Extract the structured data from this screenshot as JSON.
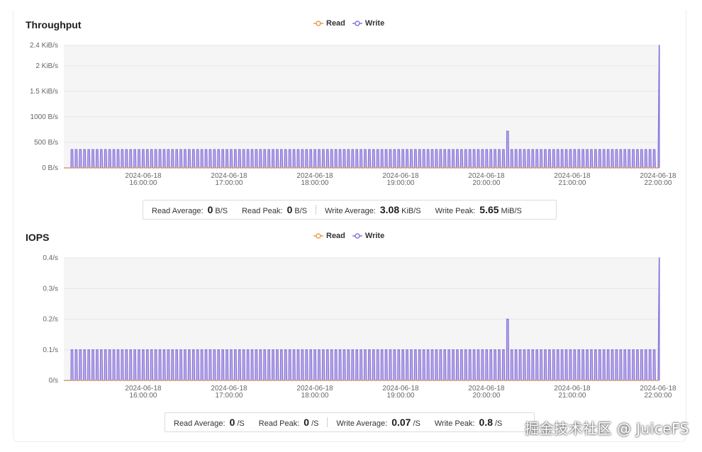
{
  "legend": {
    "read": "Read",
    "write": "Write"
  },
  "colors": {
    "read": "#e8a04a",
    "write": "#8a74dc",
    "grid": "#e6e6e6",
    "plot_bg": "#f5f5f5"
  },
  "throughput": {
    "title": "Throughput",
    "stats": {
      "read_avg_label": "Read Average:",
      "read_avg_value": "0",
      "read_avg_unit": "B/S",
      "read_peak_label": "Read Peak:",
      "read_peak_value": "0",
      "read_peak_unit": "B/S",
      "write_avg_label": "Write Average:",
      "write_avg_value": "3.08",
      "write_avg_unit": "KiB/S",
      "write_peak_label": "Write Peak:",
      "write_peak_value": "5.65",
      "write_peak_unit": "MiB/S"
    }
  },
  "iops": {
    "title": "IOPS",
    "stats": {
      "read_avg_label": "Read Average:",
      "read_avg_value": "0",
      "read_avg_unit": "/S",
      "read_peak_label": "Read Peak:",
      "read_peak_value": "0",
      "read_peak_unit": "/S",
      "write_avg_label": "Write Average:",
      "write_avg_value": "0.07",
      "write_avg_unit": "/S",
      "write_peak_label": "Write Peak:",
      "write_peak_value": "0.8",
      "write_peak_unit": "/S"
    }
  },
  "watermark": "掘金技术社区 @ JuiceFS",
  "chart_data": [
    {
      "type": "area",
      "title": "Throughput",
      "yticks": [
        "0 B/s",
        "500 B/s",
        "1000 B/s",
        "1.5 KiB/s",
        "2 KiB/s",
        "2.4 KiB/s"
      ],
      "ytick_values": [
        0,
        500,
        1000,
        1500,
        2000,
        2400
      ],
      "ylim": [
        0,
        2400
      ],
      "xticks": [
        [
          "2024-06-18",
          "16:00:00"
        ],
        [
          "2024-06-18",
          "17:00:00"
        ],
        [
          "2024-06-18",
          "18:00:00"
        ],
        [
          "2024-06-18",
          "19:00:00"
        ],
        [
          "2024-06-18",
          "20:00:00"
        ],
        [
          "2024-06-18",
          "21:00:00"
        ],
        [
          "2024-06-18",
          "22:00:00"
        ]
      ],
      "series": [
        {
          "name": "Read",
          "color": "#e8a04a",
          "baseline": 0
        },
        {
          "name": "Write",
          "color": "#8a74dc",
          "pulse_value": 360,
          "pulse_count": 140,
          "spike_value": 720,
          "final_value": 2400
        }
      ],
      "grid": true,
      "legend": "top-center"
    },
    {
      "type": "area",
      "title": "IOPS",
      "yticks": [
        "0/s",
        "0.1/s",
        "0.2/s",
        "0.3/s",
        "0.4/s"
      ],
      "ytick_values": [
        0,
        0.1,
        0.2,
        0.3,
        0.4
      ],
      "ylim": [
        0,
        0.4
      ],
      "xticks": [
        [
          "2024-06-18",
          "16:00:00"
        ],
        [
          "2024-06-18",
          "17:00:00"
        ],
        [
          "2024-06-18",
          "18:00:00"
        ],
        [
          "2024-06-18",
          "19:00:00"
        ],
        [
          "2024-06-18",
          "20:00:00"
        ],
        [
          "2024-06-18",
          "21:00:00"
        ],
        [
          "2024-06-18",
          "22:00:00"
        ]
      ],
      "series": [
        {
          "name": "Read",
          "color": "#e8a04a",
          "baseline": 0
        },
        {
          "name": "Write",
          "color": "#8a74dc",
          "pulse_value": 0.1,
          "pulse_count": 140,
          "spike_value": 0.2,
          "final_value": 0.4
        }
      ],
      "grid": true,
      "legend": "top-center"
    }
  ]
}
